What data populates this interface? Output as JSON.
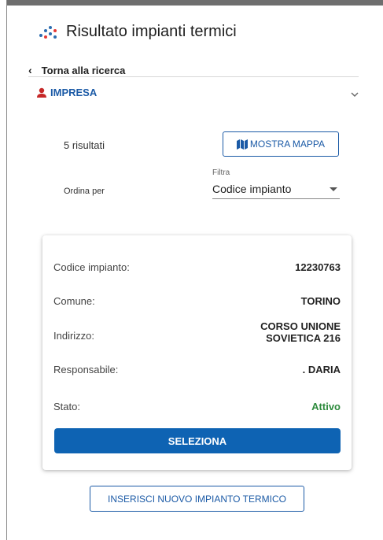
{
  "header": {
    "title": "Risultato impianti termici"
  },
  "nav": {
    "back_label": "Torna alla ricerca"
  },
  "section": {
    "label": "IMPRESA"
  },
  "results": {
    "count_label": "5 risultati",
    "map_button_label": "MOSTRA MAPPA"
  },
  "sort": {
    "order_label": "Ordina per",
    "filter_label": "Filtra",
    "selected_value": "Codice impianto"
  },
  "card": {
    "code_label": "Codice impianto:",
    "code_value": "12230763",
    "comune_label": "Comune:",
    "comune_value": "TORINO",
    "address_label": "Indirizzo:",
    "address_line1": "CORSO UNIONE",
    "address_line2": "SOVIETICA 216",
    "responsible_label": "Responsabile:",
    "responsible_value": ". DARIA",
    "status_label": "Stato:",
    "status_value": "Attivo",
    "select_button_label": "SELEZIONA"
  },
  "footer": {
    "new_button_label": "INSERISCI NUOVO IMPIANTO TERMICO"
  },
  "colors": {
    "accent": "#0e63b3",
    "section_blue": "#1b5aa6",
    "person_red": "#c62828",
    "status_green": "#2e8b3d"
  },
  "icons": [
    "dots-logo-icon",
    "chevron-left-icon",
    "person-icon",
    "chevron-down-icon",
    "map-icon",
    "dropdown-caret-icon"
  ]
}
